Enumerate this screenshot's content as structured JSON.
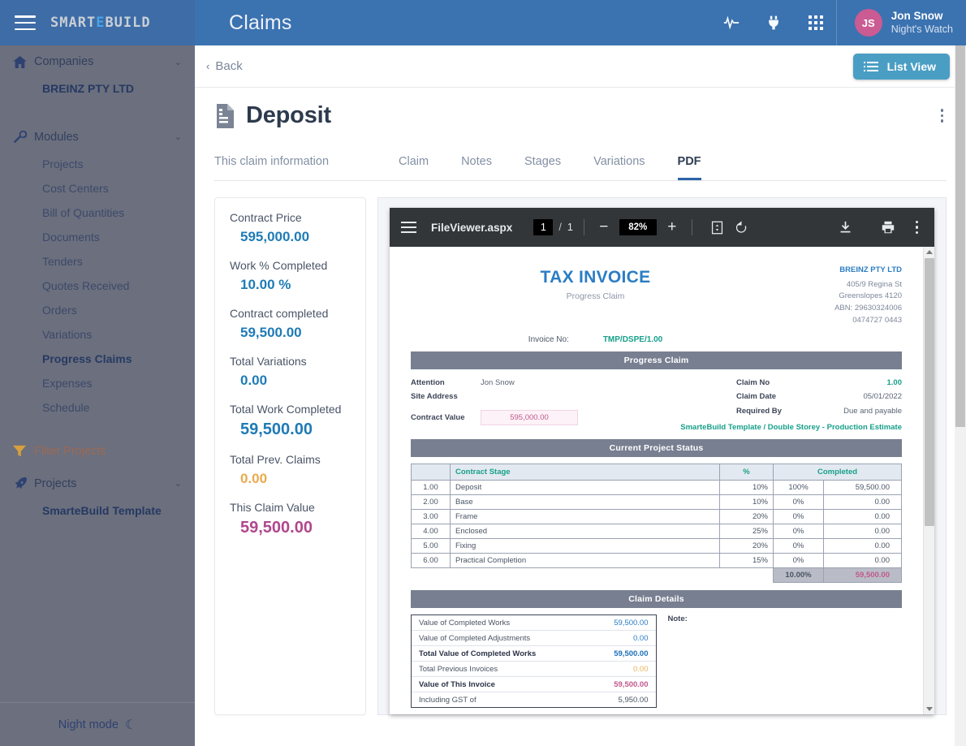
{
  "header": {
    "brand_main": "SMART",
    "brand_accent": "E",
    "brand_tail": "BUILD",
    "app_title": "Claims",
    "icons": [
      "activity-icon",
      "plug-icon",
      "apps-grid-icon"
    ],
    "user": {
      "initials": "JS",
      "name": "Jon Snow",
      "role": "Night's Watch"
    }
  },
  "sidebar": {
    "companies": {
      "label": "Companies",
      "chevron": "⌄",
      "items": [
        "BREINZ PTY LTD"
      ]
    },
    "modules": {
      "label": "Modules",
      "chevron": "⌄",
      "items": [
        "Projects",
        "Cost Centers",
        "Bill of Quantities",
        "Documents",
        "Tenders",
        "Quotes Received",
        "Orders",
        "Variations",
        "Progress Claims",
        "Expenses",
        "Schedule"
      ],
      "active": "Progress Claims"
    },
    "filter_projects": "Filter Projects",
    "projects": {
      "label": "Projects",
      "chevron": "⌄",
      "items": [
        "SmarteBuild Template"
      ]
    },
    "night_mode": "Night mode",
    "moon": "☾"
  },
  "subbar": {
    "back": "Back",
    "back_chevron": "‹",
    "list_view": "List View"
  },
  "page": {
    "title": "Deposit",
    "tabs": [
      {
        "label": "This claim information",
        "active": false
      },
      {
        "label": "Claim",
        "active": false
      },
      {
        "label": "Notes",
        "active": false
      },
      {
        "label": "Stages",
        "active": false
      },
      {
        "label": "Variations",
        "active": false
      },
      {
        "label": "PDF",
        "active": true
      }
    ]
  },
  "info_card": [
    {
      "label": "Contract Price",
      "value": "595,000.00",
      "color": "blue"
    },
    {
      "label": "Work % Completed",
      "value": "10.00 %",
      "color": "blue"
    },
    {
      "label": "Contract completed",
      "value": "59,500.00",
      "color": "blue"
    },
    {
      "label": "Total Variations",
      "value": "0.00",
      "color": "blue"
    },
    {
      "label": "Total Work Completed",
      "value": "59,500.00",
      "color": "blue"
    },
    {
      "label": "Total Prev. Claims",
      "value": "0.00",
      "color": "orange"
    },
    {
      "label": "This Claim Value",
      "value": "59,500.00",
      "color": "magenta"
    }
  ],
  "pdf_toolbar": {
    "filename": "FileViewer.aspx",
    "page_current": "1",
    "page_separator": "/",
    "page_total": "1",
    "zoom_out": "−",
    "zoom_level": "82%",
    "zoom_in": "+",
    "fit_page_icon": "fit-page-icon",
    "rotate_icon": "rotate-icon",
    "download_icon": "download-icon",
    "print_icon": "print-icon",
    "more_icon": "more-options-icon"
  },
  "invoice": {
    "title": "TAX INVOICE",
    "subtitle": "Progress Claim",
    "invoice_no_label": "Invoice No:",
    "invoice_no_value": "TMP/DSPE/1.00",
    "company": {
      "name": "BREINZ PTY LTD",
      "address1": "405/9 Regina St",
      "address2": "Greenslopes 4120",
      "abn": "ABN: 29630324006",
      "phone": "0474727 0443"
    },
    "band_progress_claim": "Progress Claim",
    "attention_label": "Attention",
    "attention_value": "Jon Snow",
    "site_address_label": "Site Address",
    "site_address_value": "",
    "contract_value_label": "Contract Value",
    "contract_value": "595,000.00",
    "claim_no_label": "Claim No",
    "claim_no_value": "1.00",
    "claim_date_label": "Claim Date",
    "claim_date_value": "05/01/2022",
    "required_by_label": "Required By",
    "required_by_value": "Due and payable",
    "project_line": "SmarteBuild Template / Double Storey - Production Estimate",
    "band_project_status": "Current Project Status",
    "stages_headers": [
      "",
      "Contract Stage",
      "%",
      "Completed"
    ],
    "stages": [
      {
        "no": "1.00",
        "stage": "Deposit",
        "pct": "10%",
        "completed_pct": "100%",
        "amount": "59,500.00"
      },
      {
        "no": "2.00",
        "stage": "Base",
        "pct": "10%",
        "completed_pct": "0%",
        "amount": "0.00"
      },
      {
        "no": "3.00",
        "stage": "Frame",
        "pct": "20%",
        "completed_pct": "0%",
        "amount": "0.00"
      },
      {
        "no": "4.00",
        "stage": "Enclosed",
        "pct": "25%",
        "completed_pct": "0%",
        "amount": "0.00"
      },
      {
        "no": "5.00",
        "stage": "Fixing",
        "pct": "20%",
        "completed_pct": "0%",
        "amount": "0.00"
      },
      {
        "no": "6.00",
        "stage": "Practical Completion",
        "pct": "15%",
        "completed_pct": "0%",
        "amount": "0.00"
      }
    ],
    "stages_total_pct": "10.00%",
    "stages_total_amount": "59,500.00",
    "band_claim_details": "Claim Details",
    "claim_details": [
      {
        "label": "Value of Completed Works",
        "amount": "59,500.00",
        "bold": false,
        "color": "blue"
      },
      {
        "label": "Value of Completed Adjustments",
        "amount": "0.00",
        "bold": false,
        "color": "blue"
      },
      {
        "label": "Total Value of Completed Works",
        "amount": "59,500.00",
        "bold": true,
        "color": "blue"
      },
      {
        "label": "Total Previous Invoices",
        "amount": "0.00",
        "bold": false,
        "color": "orange"
      },
      {
        "label": "Value of This Invoice",
        "amount": "59,500.00",
        "bold": true,
        "color": "magenta"
      },
      {
        "label": "Including GST of",
        "amount": "5,950.00",
        "bold": false,
        "color": "blue"
      }
    ],
    "note_label": "Note:"
  },
  "colors": {
    "header_blue": "#3b72b0",
    "brand_blue": "#3d6ca6",
    "sidebar_grey": "#6c6f7d",
    "accent_teal": "#17a08a",
    "value_blue": "#1f7bb6",
    "value_orange": "#e8aa4e",
    "value_magenta": "#b0488d",
    "listview_blue": "#4a9ec4",
    "pdf_toolbar_dark": "#323639"
  }
}
